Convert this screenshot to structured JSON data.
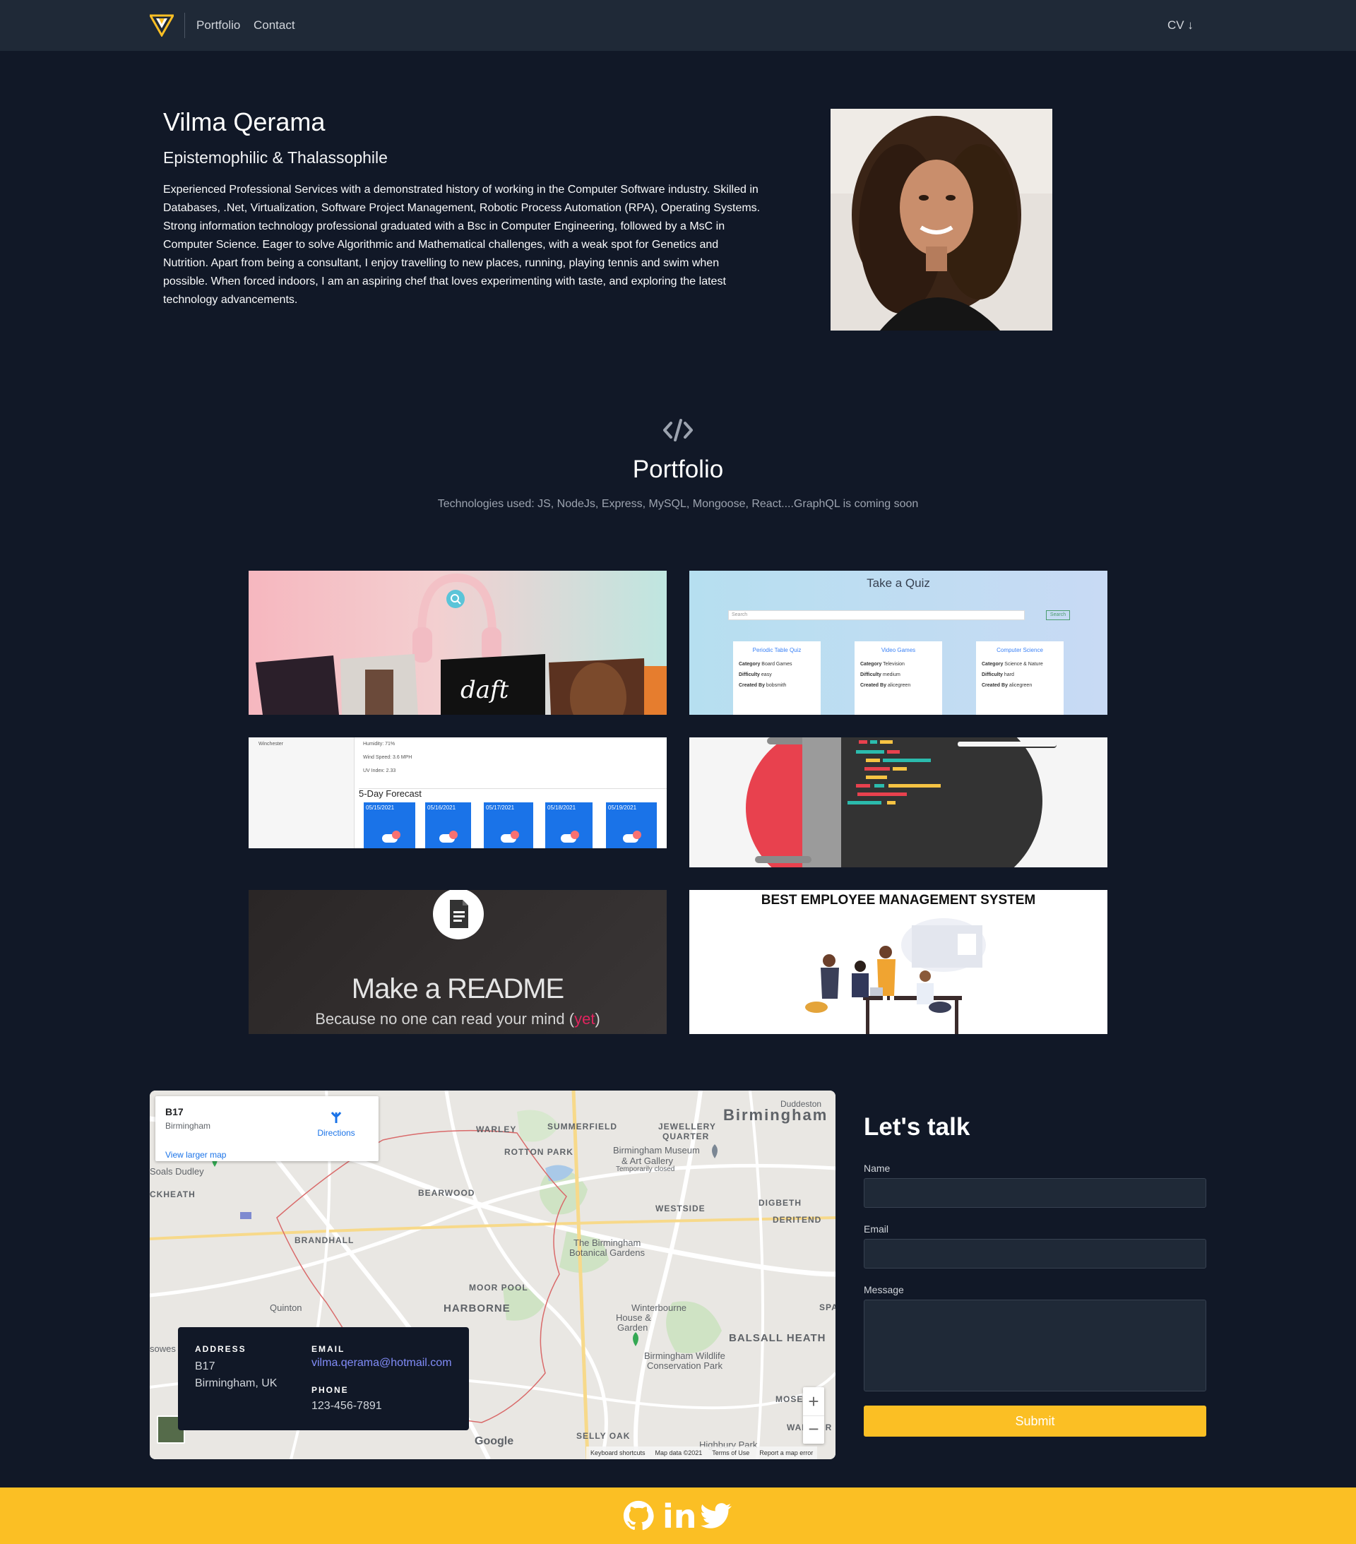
{
  "nav": {
    "logo": "logo-icon",
    "links": [
      "Portfolio",
      "Contact"
    ],
    "cv_label": "CV ↓"
  },
  "hero": {
    "name": "Vilma Qerama",
    "subtitle": "Epistemophilic & Thalassophile",
    "bio": "Experienced Professional Services with a demonstrated history of working in the Computer Software industry. Skilled in Databases, .Net, Virtualization, Software Project Management, Robotic Process Automation (RPA), Operating Systems. Strong information technology professional graduated with a Bsc in Computer Engineering, followed by a MsC in Computer Science. Eager to solve Algorithmic and Mathematical challenges, with a weak spot for Genetics and Nutrition. Apart from being a consultant, I enjoy travelling to new places, running, playing tennis and swim when possible. When forced indoors, I am an aspiring chef that loves experimenting with taste, and exploring the latest technology advancements."
  },
  "portfolio": {
    "icon": "code-icon",
    "title": "Portfolio",
    "tech": "Technologies used: JS, NodeJs, Express, MySQL, Mongoose, React....GraphQL is coming soon",
    "quiz": {
      "title": "Take a Quiz",
      "search_placeholder": "Search",
      "search_button": "Search",
      "cards": [
        {
          "title": "Periodic Table Quiz",
          "category": "Board Games",
          "difficulty": "easy",
          "created_by": "bobsmith"
        },
        {
          "title": "Video Games",
          "category": "Television",
          "difficulty": "medium",
          "created_by": "alicegreen"
        },
        {
          "title": "Computer Science",
          "category": "Science & Nature",
          "difficulty": "hard",
          "created_by": "alicegreen"
        }
      ],
      "labels": {
        "category": "Category",
        "difficulty": "Difficulty",
        "created_by": "Created By"
      }
    },
    "weather": {
      "city": "Winchester",
      "humidity": "Humidity: 71%",
      "wind": "Wind Speed: 3.6 MPH",
      "uv": "UV Index: 2.33",
      "forecast_title": "5-Day Forecast",
      "days": [
        "05/15/2021",
        "05/16/2021",
        "05/17/2021",
        "05/18/2021",
        "05/19/2021"
      ]
    },
    "readme": {
      "title": "Make a README",
      "subtitle_prefix": "Because no one can read your mind (",
      "subtitle_highlight": "yet",
      "subtitle_suffix": ")"
    },
    "ems": {
      "title": "BEST EMPLOYEE MANAGEMENT SYSTEM"
    }
  },
  "map": {
    "place": "B17",
    "place_sub": "Birmingham",
    "directions": "Directions",
    "larger": "View larger map",
    "labels": {
      "birmingham": "Birmingham",
      "duddeston": "Duddeston",
      "warley": "WARLEY",
      "summerfield": "SUMMERFIELD",
      "jewellery": "JEWELLERY",
      "quarter": "QUARTER",
      "rotton": "ROTTON PARK",
      "museum1": "Birmingham Museum",
      "museum2": "& Art Gallery",
      "museum3": "Temporarily closed",
      "soals": "Soals Dudley",
      "ckheath": "CKHEATH",
      "bearwood": "BEARWOOD",
      "westside": "WESTSIDE",
      "digbeth": "DIGBETH",
      "deritend": "DERITEND",
      "brandhall": "BRANDHALL",
      "botanical1": "The Birmingham",
      "botanical2": "Botanical Gardens",
      "moorpool": "MOOR POOL",
      "harborne": "HARBORNE",
      "quinton": "Quinton",
      "winterbourne1": "Winterbourne",
      "winterbourne2": "House &",
      "winterbourne3": "Garden",
      "balsall": "BALSALL HEATH",
      "spa": "SPA",
      "wildlife1": "Birmingham Wildlife",
      "wildlife2": "Conservation Park",
      "mose": "MOSE",
      "wakegr": "WAKE GR",
      "sellyoak": "SELLY OAK",
      "highbury": "Highbury Park",
      "sowes": "sowes"
    },
    "zoom_in": "+",
    "zoom_out": "−",
    "google": "Google",
    "footer": [
      "Keyboard shortcuts",
      "Map data ©2021",
      "Terms of Use",
      "Report a map error"
    ]
  },
  "info": {
    "address_label": "ADDRESS",
    "address_1": "B17",
    "address_2": "Birmingham, UK",
    "email_label": "EMAIL",
    "email": "vilma.qerama@hotmail.com",
    "phone_label": "PHONE",
    "phone": "123-456-7891"
  },
  "contact": {
    "title": "Let's talk",
    "name_label": "Name",
    "email_label": "Email",
    "message_label": "Message",
    "submit": "Submit"
  },
  "footer": {
    "icons": [
      "github-icon",
      "linkedin-icon",
      "twitter-icon"
    ],
    "linkedin_text": "in"
  },
  "colors": {
    "background": "#111827",
    "nav": "#1f2937",
    "accent": "#fbbf24",
    "link": "#818cf8"
  }
}
